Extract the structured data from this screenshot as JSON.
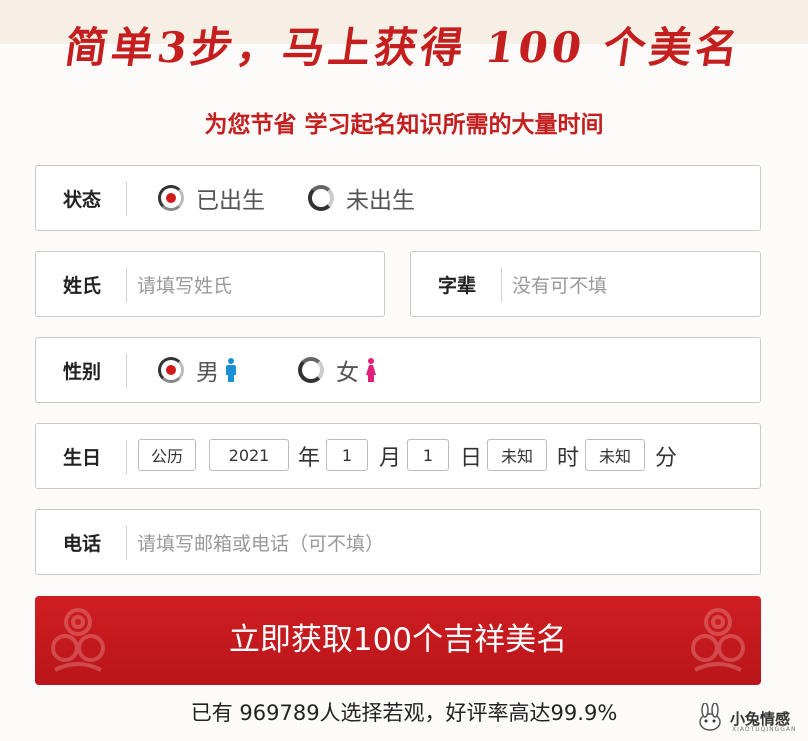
{
  "header": {
    "title": "简单3步，马上获得 100 个美名",
    "subtitle": "为您节省 学习起名知识所需的大量时间"
  },
  "form": {
    "status": {
      "label": "状态",
      "options": [
        "已出生",
        "未出生"
      ],
      "selected": "已出生"
    },
    "surname": {
      "label": "姓氏",
      "placeholder": "请填写姓氏"
    },
    "generation": {
      "label": "字辈",
      "placeholder": "没有可不填"
    },
    "gender": {
      "label": "性别",
      "options": [
        "男",
        "女"
      ],
      "selected": "男"
    },
    "birthday": {
      "label": "生日",
      "calendar": "公历",
      "year": "2021",
      "year_unit": "年",
      "month": "1",
      "month_unit": "月",
      "day": "1",
      "day_unit": "日",
      "hour": "未知",
      "hour_unit": "时",
      "minute": "未知",
      "minute_unit": "分"
    },
    "phone": {
      "label": "电话",
      "placeholder": "请填写邮箱或电话（可不填）"
    }
  },
  "cta": {
    "label": "立即获取100个吉祥美名"
  },
  "footer": {
    "text": "已有 969789人选择若观，好评率高达99.9%"
  },
  "watermark": {
    "text": "小兔情感",
    "sub": "XIAOTUQINGGAN"
  },
  "colors": {
    "brand_red": "#c41e1e",
    "male_icon": "#1a8fd6",
    "female_icon": "#e0207a"
  }
}
